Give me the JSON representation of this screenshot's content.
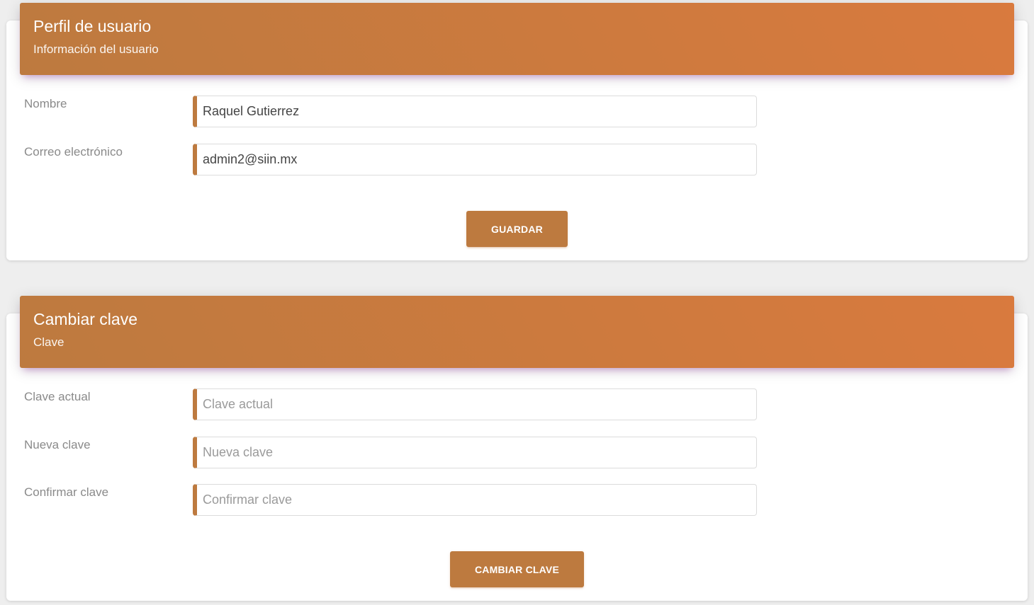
{
  "profile": {
    "title": "Perfil de usuario",
    "subtitle": "Información del usuario",
    "name_label": "Nombre",
    "name_value": "Raquel Gutierrez",
    "email_label": "Correo electrónico",
    "email_value": "admin2@siin.mx",
    "save_button": "GUARDAR"
  },
  "password": {
    "title": "Cambiar clave",
    "subtitle": "Clave",
    "current_label": "Clave actual",
    "current_placeholder": "Clave actual",
    "new_label": "Nueva clave",
    "new_placeholder": "Nueva clave",
    "confirm_label": "Confirmar clave",
    "confirm_placeholder": "Confirmar clave",
    "change_button": "CAMBIAR CLAVE"
  },
  "colors": {
    "accent": "#bd7a3f",
    "header_gradient_end": "#d97a3e",
    "background": "#eeeeee"
  }
}
